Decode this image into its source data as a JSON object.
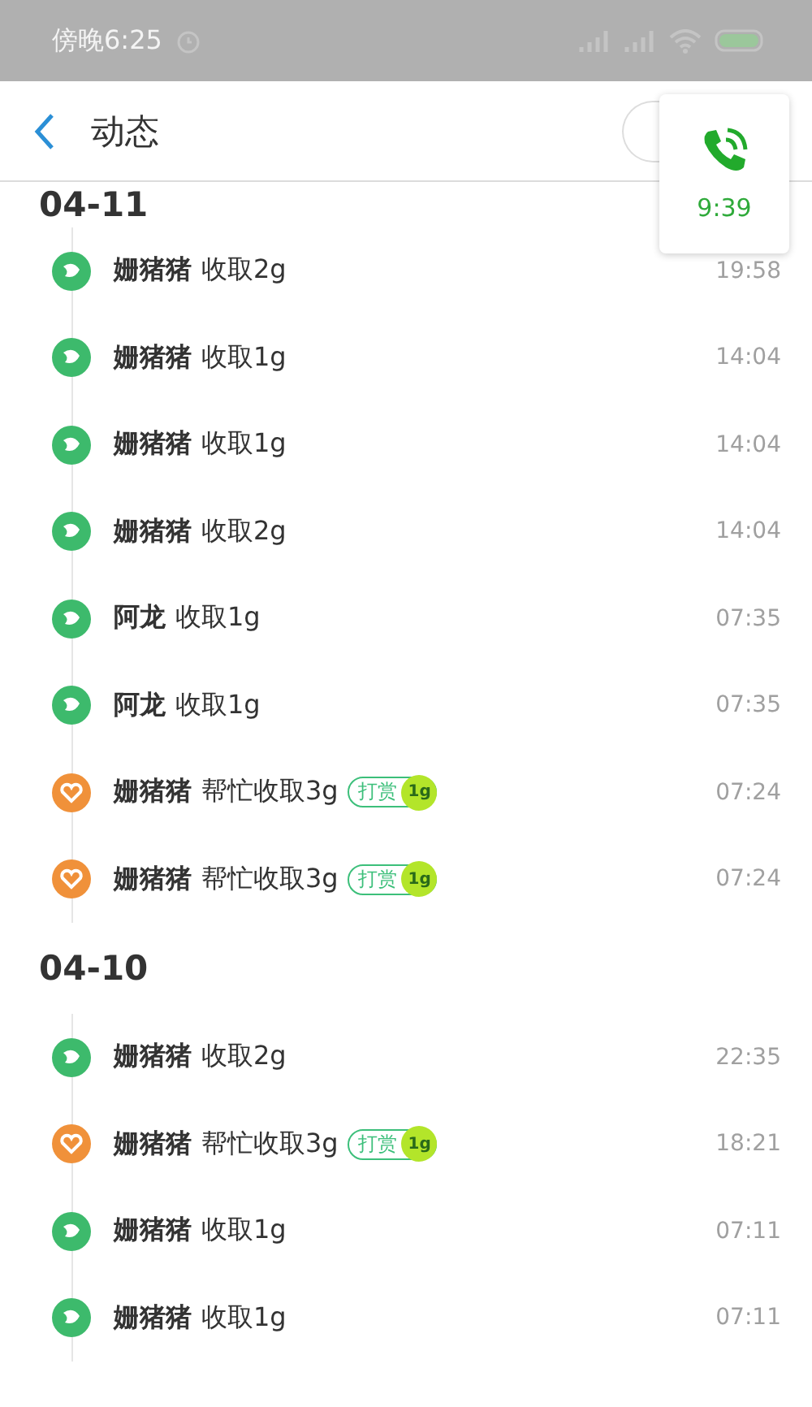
{
  "status_bar": {
    "time": "傍晚6:25"
  },
  "header": {
    "title": "动态"
  },
  "call_widget": {
    "duration": "9:39"
  },
  "sections": [
    {
      "date": "04-11",
      "items": [
        {
          "kind": "collect",
          "name": "姗猪猪",
          "action": "收取2g",
          "time": "19:58"
        },
        {
          "kind": "collect",
          "name": "姗猪猪",
          "action": "收取1g",
          "time": "14:04"
        },
        {
          "kind": "collect",
          "name": "姗猪猪",
          "action": "收取1g",
          "time": "14:04"
        },
        {
          "kind": "collect",
          "name": "姗猪猪",
          "action": "收取2g",
          "time": "14:04"
        },
        {
          "kind": "collect",
          "name": "阿龙",
          "action": "收取1g",
          "time": "07:35"
        },
        {
          "kind": "collect",
          "name": "阿龙",
          "action": "收取1g",
          "time": "07:35"
        },
        {
          "kind": "help",
          "name": "姗猪猪",
          "action": "帮忙收取3g",
          "reward_label": "打赏",
          "reward": "1g",
          "time": "07:24"
        },
        {
          "kind": "help",
          "name": "姗猪猪",
          "action": "帮忙收取3g",
          "reward_label": "打赏",
          "reward": "1g",
          "time": "07:24"
        }
      ]
    },
    {
      "date": "04-10",
      "items": [
        {
          "kind": "collect",
          "name": "姗猪猪",
          "action": "收取2g",
          "time": "22:35"
        },
        {
          "kind": "help",
          "name": "姗猪猪",
          "action": "帮忙收取3g",
          "reward_label": "打赏",
          "reward": "1g",
          "time": "18:21"
        },
        {
          "kind": "collect",
          "name": "姗猪猪",
          "action": "收取1g",
          "time": "07:11"
        },
        {
          "kind": "collect",
          "name": "姗猪猪",
          "action": "收取1g",
          "time": "07:11"
        }
      ]
    }
  ]
}
